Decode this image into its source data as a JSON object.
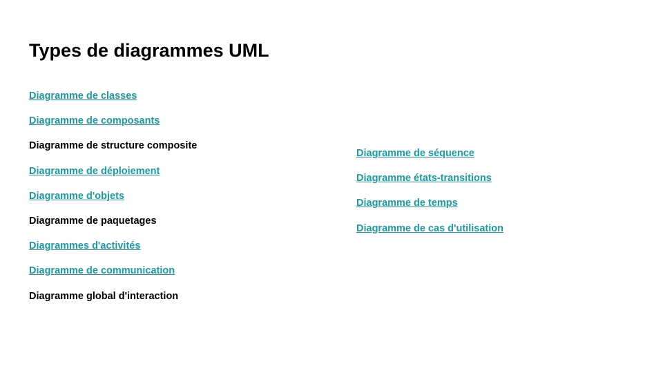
{
  "title": "Types de diagrammes UML",
  "link_color": "#1a9ba1",
  "left_column": [
    {
      "label": "Diagramme de classes",
      "link": true
    },
    {
      "label": "Diagramme de composants",
      "link": true
    },
    {
      "label": "Diagramme de structure composite",
      "link": false
    },
    {
      "label": "Diagramme de déploiement",
      "link": true
    },
    {
      "label": "Diagramme d'objets",
      "link": true
    },
    {
      "label": "Diagramme de paquetages",
      "link": false
    },
    {
      "label": "Diagrammes d'activités",
      "link": true
    },
    {
      "label": "Diagramme de communication",
      "link": true
    },
    {
      "label": "Diagramme global d'interaction",
      "link": false
    }
  ],
  "right_column": [
    {
      "label": "Diagramme de séquence",
      "link": true
    },
    {
      "label": "Diagramme états-transitions",
      "link": true
    },
    {
      "label": "Diagramme de temps",
      "link": true
    },
    {
      "label": "Diagramme de cas d'utilisation",
      "link": true
    }
  ]
}
